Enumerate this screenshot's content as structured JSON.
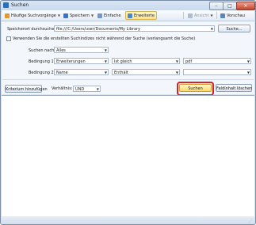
{
  "window": {
    "title": "Suchen",
    "minimize": "–",
    "maximize": "□",
    "close": "✕"
  },
  "toolbar": {
    "recent_searches": "Häufige Suchvorgänge",
    "save": "Speichern",
    "simple": "Einfache",
    "advanced": "Erweiterte",
    "result": "Ansicht",
    "preview": "Vorschau"
  },
  "search": {
    "search_location_label": "Speicherort durchsuchen",
    "search_location_value": "file:///C:/Users/user/Documents/My Library",
    "browse_button": "Suche...",
    "checkbox_label": "Verwenden Sie die erstellten Suchindizes nicht während der Suche (verlangsamt die Suche)",
    "search_for_label": "Suchen nach:",
    "search_for_value": "Alles",
    "condition1_label": "Bedingung 1",
    "condition1_field": "Erweiterungen",
    "condition1_operator": "Ist gleich",
    "condition1_value": "pdf",
    "condition2_label": "Bedingung 2",
    "condition2_field": "Name",
    "condition2_operator": "Enthält",
    "condition2_value": ""
  },
  "actions": {
    "add_criterion": "Kriterium hinzufügen",
    "relation_label": "Verhältnis:",
    "relation_value": "UND",
    "search_button": "Suchen",
    "clear_button": "Feldinhalt löschen"
  },
  "colors": {
    "highlight": "#d8202a",
    "accent": "#ffd96a"
  }
}
